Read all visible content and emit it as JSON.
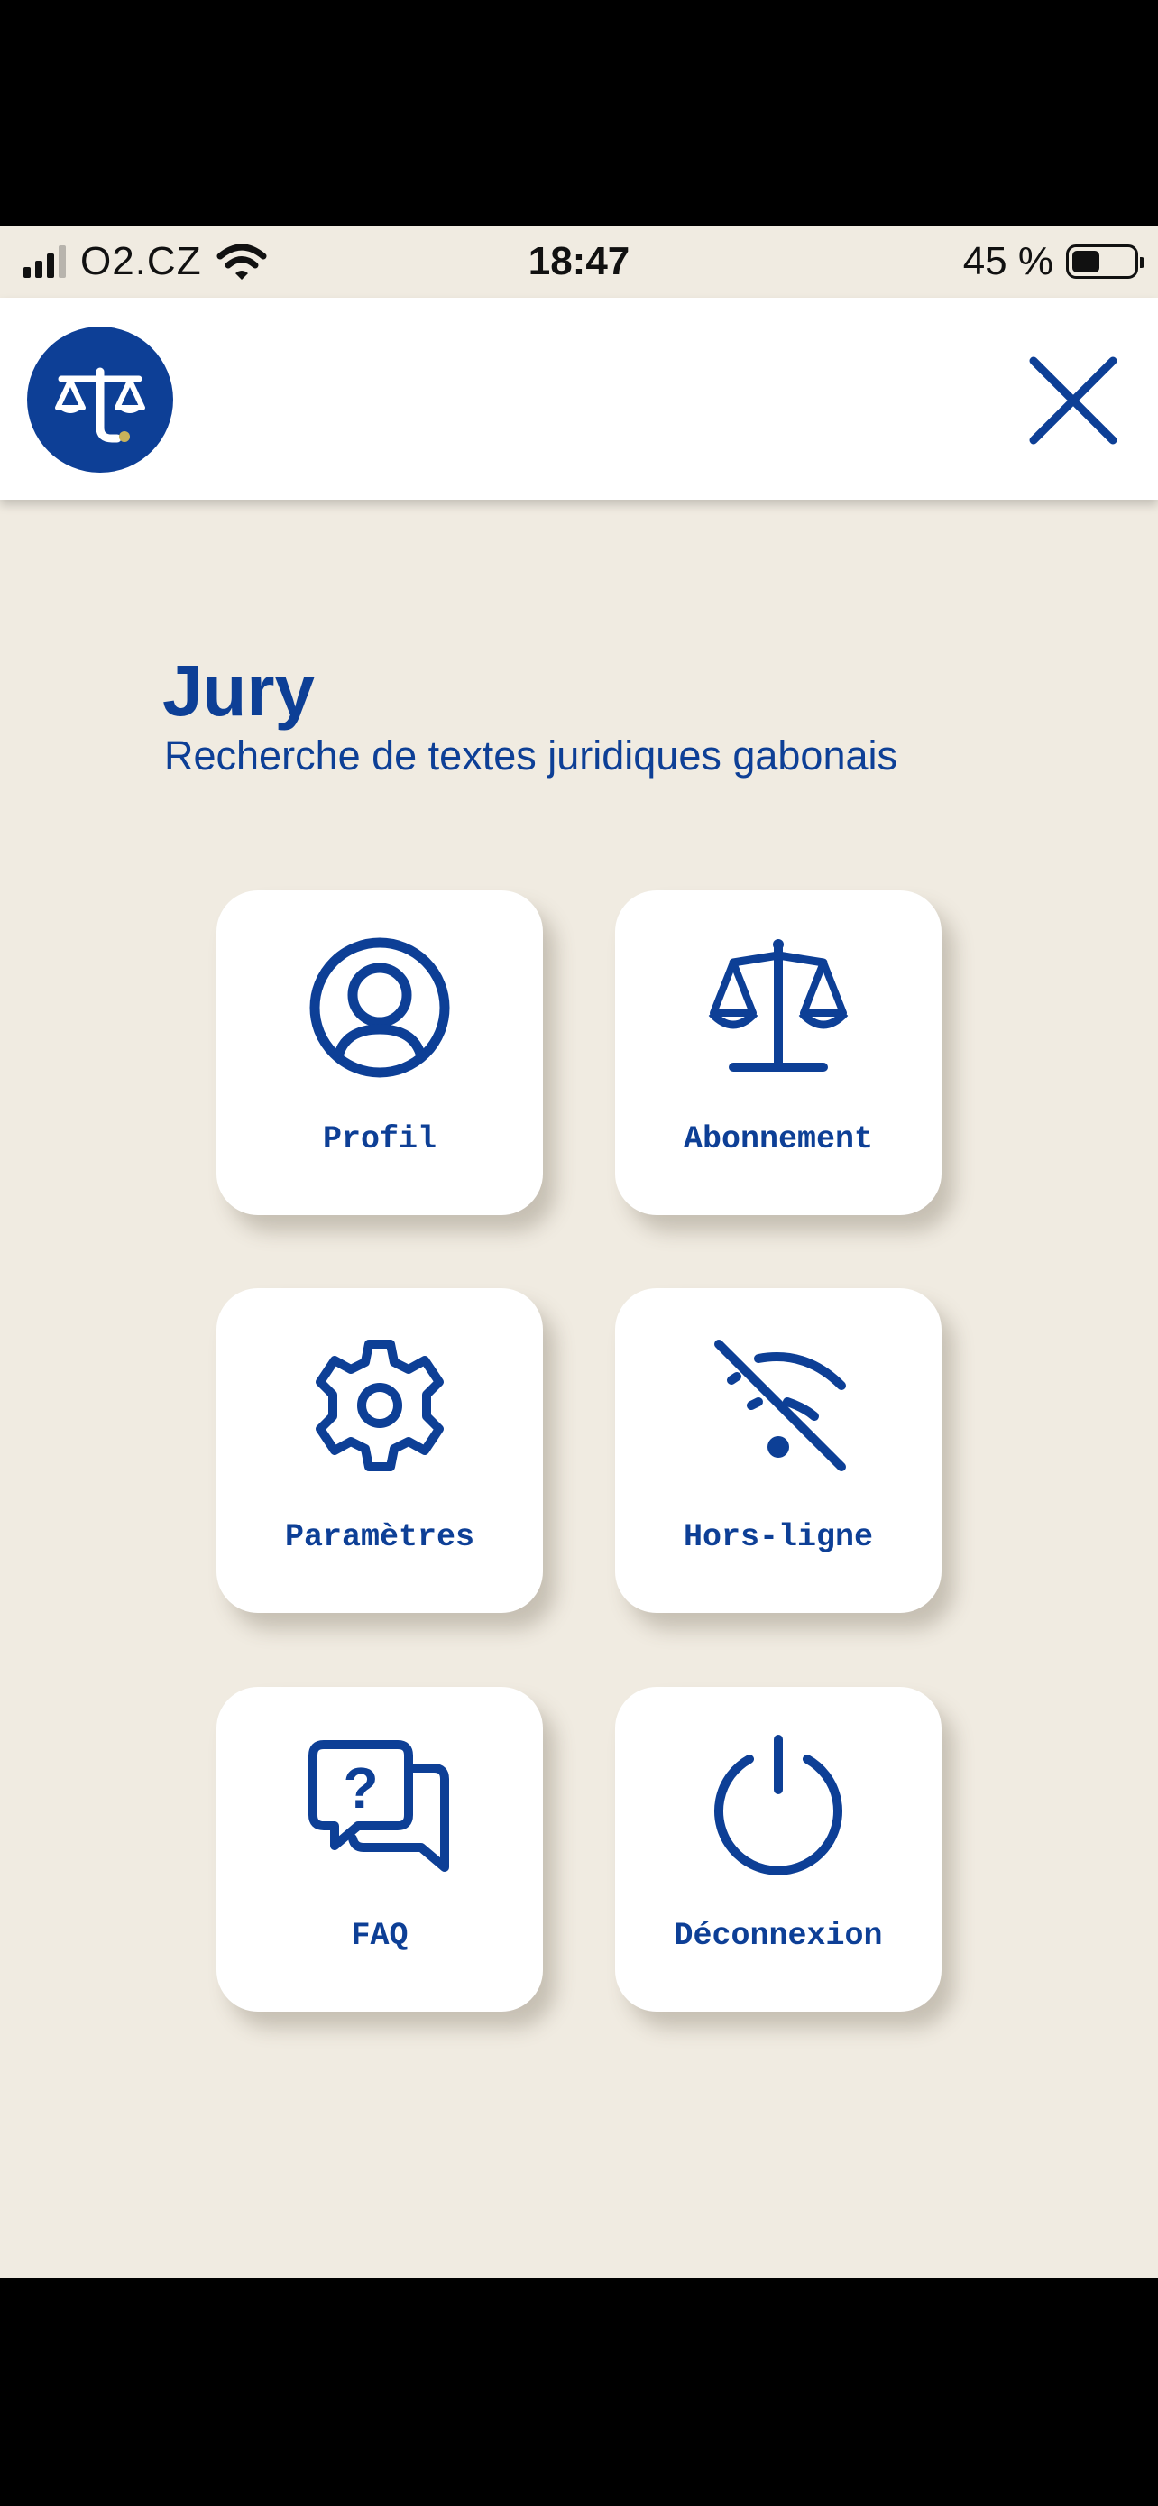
{
  "status_bar": {
    "carrier": "O2.CZ",
    "time": "18:47",
    "battery_percent": "45 %",
    "battery_level": 0.45
  },
  "header": {
    "logo_icon": "scales-of-justice-logo",
    "close_icon": "close-icon"
  },
  "app": {
    "title": "Jury",
    "subtitle": "Recherche de textes juridiques gabonais"
  },
  "menu": {
    "items": [
      {
        "label": "Profil",
        "icon": "user-circle-icon"
      },
      {
        "label": "Abonnement",
        "icon": "scales-icon"
      },
      {
        "label": "Paramètres",
        "icon": "gear-icon"
      },
      {
        "label": "Hors-ligne",
        "icon": "wifi-off-icon"
      },
      {
        "label": "FAQ",
        "icon": "question-chat-icon"
      },
      {
        "label": "Déconnexion",
        "icon": "power-icon"
      }
    ]
  },
  "colors": {
    "primary": "#0d3f96",
    "background": "#f0ebe1",
    "card": "#ffffff"
  }
}
